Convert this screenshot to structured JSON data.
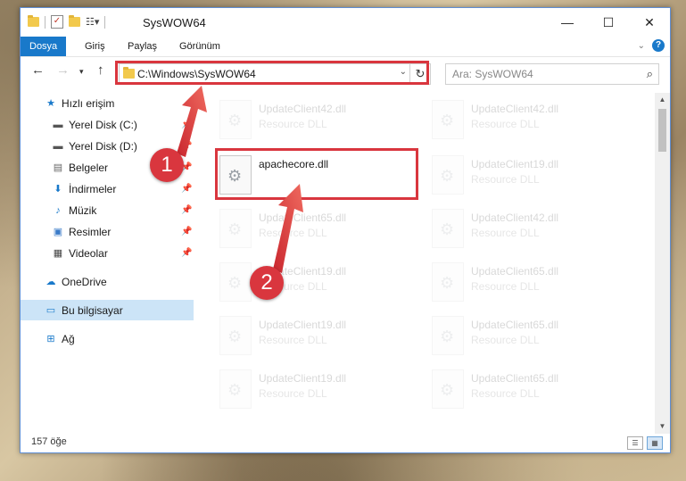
{
  "window": {
    "title": "SysWOW64"
  },
  "ribbon": {
    "tabs": [
      "Dosya",
      "Giriş",
      "Paylaş",
      "Görünüm"
    ]
  },
  "address": {
    "path": "C:\\Windows\\SysWOW64"
  },
  "search": {
    "placeholder": "Ara: SysWOW64"
  },
  "sidebar": {
    "items": [
      {
        "label": "Hızlı erişim",
        "icon": "star-icon"
      },
      {
        "label": "Yerel Disk (C:)",
        "icon": "drive-icon"
      },
      {
        "label": "Yerel Disk (D:)",
        "icon": "drive-icon"
      },
      {
        "label": "Belgeler",
        "icon": "documents-icon"
      },
      {
        "label": "İndirmeler",
        "icon": "download-icon"
      },
      {
        "label": "Müzik",
        "icon": "music-icon"
      },
      {
        "label": "Resimler",
        "icon": "pictures-icon"
      },
      {
        "label": "Videolar",
        "icon": "videos-icon"
      },
      {
        "label": "OneDrive",
        "icon": "cloud-icon"
      },
      {
        "label": "Bu bilgisayar",
        "icon": "computer-icon"
      },
      {
        "label": "Ağ",
        "icon": "network-icon"
      }
    ]
  },
  "files": [
    {
      "name": "UpdateClient42.dll",
      "desc": "Resource DLL"
    },
    {
      "name": "UpdateClient42.dll",
      "desc": "Resource DLL"
    },
    {
      "name": "apachecore.dll",
      "desc": ""
    },
    {
      "name": "UpdateClient19.dll",
      "desc": "Resource DLL"
    },
    {
      "name": "UpdateClient65.dll",
      "desc": "Resource DLL"
    },
    {
      "name": "UpdateClient42.dll",
      "desc": "Resource DLL"
    },
    {
      "name": "UpdateClient19.dll",
      "desc": "Resource DLL"
    },
    {
      "name": "UpdateClient65.dll",
      "desc": "Resource DLL"
    },
    {
      "name": "UpdateClient19.dll",
      "desc": "Resource DLL"
    },
    {
      "name": "UpdateClient65.dll",
      "desc": "Resource DLL"
    },
    {
      "name": "UpdateClient19.dll",
      "desc": "Resource DLL"
    },
    {
      "name": "UpdateClient65.dll",
      "desc": "Resource DLL"
    }
  ],
  "status": {
    "count": "157 öğe"
  },
  "markers": {
    "one": "1",
    "two": "2"
  },
  "colors": {
    "accent": "#1979ca",
    "highlight": "#d9363e"
  }
}
